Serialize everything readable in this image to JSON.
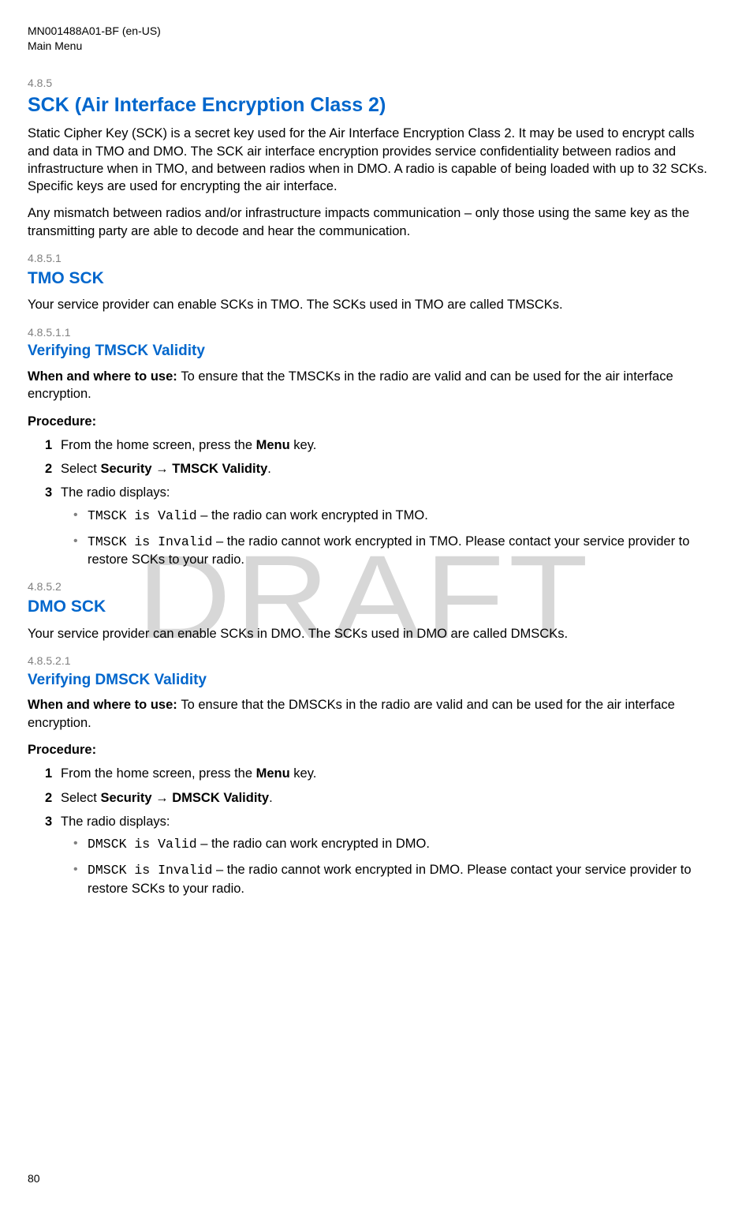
{
  "header": {
    "doc_id": "MN001488A01-BF (en-US)",
    "section_title": "Main Menu"
  },
  "watermark": "DRAFT",
  "sections": {
    "s1": {
      "num": "4.8.5",
      "title": "SCK (Air Interface Encryption Class 2)",
      "p1": "Static Cipher Key (SCK) is a secret key used for the Air Interface Encryption Class 2. It may be used to encrypt calls and data in TMO and DMO. The SCK air interface encryption provides service confidentiality between radios and infrastructure when in TMO, and between radios when in DMO. A radio is capable of being loaded with up to 32 SCKs. Specific keys are used for encrypting the air interface.",
      "p2": "Any mismatch between radios and/or infrastructure impacts communication – only those using the same key as the transmitting party are able to decode and hear the communication."
    },
    "s2": {
      "num": "4.8.5.1",
      "title": "TMO SCK",
      "p1": "Your service provider can enable SCKs in TMO. The SCKs used in TMO are called TMSCKs."
    },
    "s3": {
      "num": "4.8.5.1.1",
      "title": "Verifying TMSCK Validity",
      "when_label": "When and where to use: ",
      "when_text": "To ensure that the TMSCKs in the radio are valid and can be used for the air interface encryption.",
      "procedure_label": "Procedure:",
      "steps": {
        "n1": "1",
        "s1a": "From the home screen, press the ",
        "s1b": "Menu",
        "s1c": " key.",
        "n2": "2",
        "s2a": "Select ",
        "s2b": "Security",
        "s2arrow": " → ",
        "s2c": "TMSCK Validity",
        "s2d": ".",
        "n3": "3",
        "s3a": "The radio displays:",
        "b1code": "TMSCK is Valid",
        "b1text": " – the radio can work encrypted in TMO.",
        "b2code": "TMSCK is Invalid",
        "b2text": " – the radio cannot work encrypted in TMO. Please contact your service provider to restore SCKs to your radio."
      }
    },
    "s4": {
      "num": "4.8.5.2",
      "title": "DMO SCK",
      "p1": "Your service provider can enable SCKs in DMO. The SCKs used in DMO are called DMSCKs."
    },
    "s5": {
      "num": "4.8.5.2.1",
      "title": "Verifying DMSCK Validity",
      "when_label": "When and where to use: ",
      "when_text": "To ensure that the DMSCKs in the radio are valid and can be used for the air interface encryption.",
      "procedure_label": "Procedure:",
      "steps": {
        "n1": "1",
        "s1a": "From the home screen, press the ",
        "s1b": "Menu",
        "s1c": " key.",
        "n2": "2",
        "s2a": "Select ",
        "s2b": "Security",
        "s2arrow": " → ",
        "s2c": "DMSCK Validity",
        "s2d": ".",
        "n3": "3",
        "s3a": "The radio displays:",
        "b1code": "DMSCK is Valid",
        "b1text": " – the radio can work encrypted in DMO.",
        "b2code": "DMSCK is Invalid",
        "b2text": " – the radio cannot work encrypted in DMO. Please contact your service provider to restore SCKs to your radio."
      }
    }
  },
  "page_number": "80"
}
